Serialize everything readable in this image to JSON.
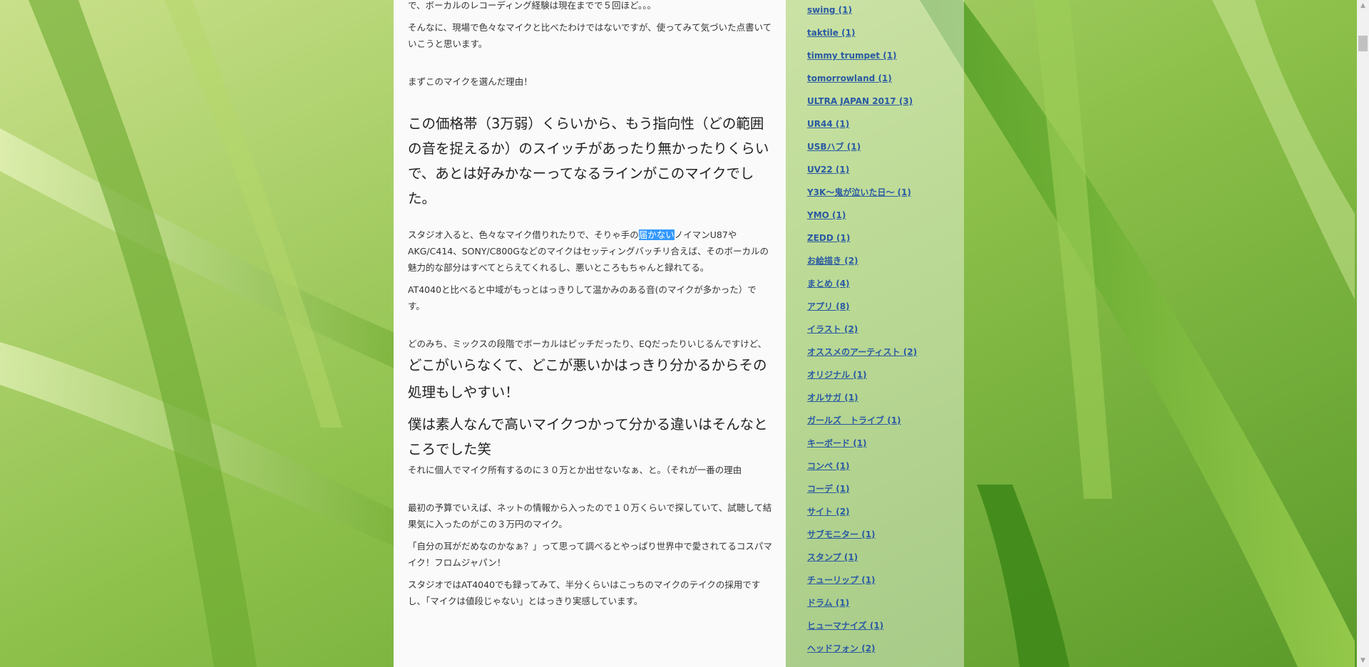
{
  "colors": {
    "accent_link": "#2a5aa2",
    "selection": "#3399ff",
    "background_green": "#7fb63a"
  },
  "article": {
    "paragraphs": [
      {
        "type": "normal",
        "text": "で、ボーカルのレコーディング経験は現在までで５回ほど。。。"
      },
      {
        "type": "normal",
        "text": "そんなに、現場で色々なマイクと比べたわけではないですが、使ってみて気づいた点書いていこうと思います。"
      },
      {
        "type": "gap"
      },
      {
        "type": "normal",
        "text": "まずこのマイクを選んだ理由！"
      },
      {
        "type": "gap"
      },
      {
        "type": "big",
        "text": "この価格帯（3万弱）くらいから、もう指向性（どの範囲の音を捉えるか）のスイッチがあったり無かったりくらいで、あとは好みかなーってなるラインがこのマイクでした。"
      },
      {
        "type": "gap"
      },
      {
        "type": "selected",
        "before": "スタジオ入ると、色々なマイク借りれたりで、そりゃ手の",
        "selected": "届かない",
        "after": "ノイマンU87やAKG/C414、SONY/C800Gなどのマイクはセッティングバッチリ合えば、そのボーカルの魅力的な部分はすべてとらえてくれるし、悪いところもちゃんと録れてる。"
      },
      {
        "type": "normal",
        "text": "AT4040と比べると中域がもっとはっきりして温かみのある音(のマイクが多かった）です。"
      },
      {
        "type": "gap"
      },
      {
        "type": "mixed",
        "small": "どのみち、ミックスの段階でボーカルはピッチだったり、EQだったりいじるんですけど、",
        "large": "どこがいらなくて、どこが悪いかはっきり分かるからその処理もしやすい！"
      },
      {
        "type": "big",
        "text": "僕は素人なんで高いマイクつかって分かる違いはそんなところでした笑"
      },
      {
        "type": "normal",
        "text": "それに個人でマイク所有するのに３０万とか出せないなぁ、と。（それが一番の理由"
      },
      {
        "type": "gap"
      },
      {
        "type": "normal",
        "text": "最初の予算でいえば、ネットの情報から入ったので１０万くらいで探していて、試聴して結果気に入ったのがこの３万円のマイク。"
      },
      {
        "type": "normal",
        "text": "「自分の耳がだめなのかなぁ？」って思って調べるとやっぱり世界中で愛されてるコスパマイク！フロムジャパン！"
      },
      {
        "type": "normal",
        "text": "スタジオではAT4040でも録ってみて、半分くらいはこっちのマイクのテイクの採用ですし、「マイクは値段じゃない」とはっきり実感しています。"
      }
    ]
  },
  "sidebar": {
    "tags": [
      {
        "label": "swing",
        "count": "(1)"
      },
      {
        "label": "taktile",
        "count": "(1)"
      },
      {
        "label": "timmy trumpet",
        "count": "(1)"
      },
      {
        "label": "tomorrowland",
        "count": "(1)"
      },
      {
        "label": "ULTRA JAPAN 2017",
        "count": "(3)"
      },
      {
        "label": "UR44",
        "count": "(1)"
      },
      {
        "label": "USBハブ",
        "count": "(1)"
      },
      {
        "label": "UV22",
        "count": "(1)"
      },
      {
        "label": "Y3K～鬼が泣いた日～",
        "count": "(1)"
      },
      {
        "label": "YMO",
        "count": "(1)"
      },
      {
        "label": "ZEDD",
        "count": "(1)"
      },
      {
        "label": "お絵描き",
        "count": "(2)"
      },
      {
        "label": "まとめ",
        "count": "(4)"
      },
      {
        "label": "アプリ",
        "count": "(8)"
      },
      {
        "label": "イラスト",
        "count": "(2)"
      },
      {
        "label": "オススメのアーティスト",
        "count": "(2)"
      },
      {
        "label": "オリジナル",
        "count": "(1)"
      },
      {
        "label": "オルサガ",
        "count": "(1)"
      },
      {
        "label": "ガールズ　トライブ",
        "count": "(1)"
      },
      {
        "label": "キーボード",
        "count": "(1)"
      },
      {
        "label": "コンペ",
        "count": "(1)"
      },
      {
        "label": "コーデ",
        "count": "(1)"
      },
      {
        "label": "サイト",
        "count": "(2)"
      },
      {
        "label": "サブモニター",
        "count": "(1)"
      },
      {
        "label": "スタンプ",
        "count": "(1)"
      },
      {
        "label": "チューリップ",
        "count": "(1)"
      },
      {
        "label": "ドラム",
        "count": "(1)"
      },
      {
        "label": "ヒューマナイズ",
        "count": "(1)"
      },
      {
        "label": "ヘッドフォン",
        "count": "(2)"
      }
    ]
  },
  "scrollbar": {
    "up_icon": "triangle-up",
    "down_icon": "triangle-down"
  }
}
